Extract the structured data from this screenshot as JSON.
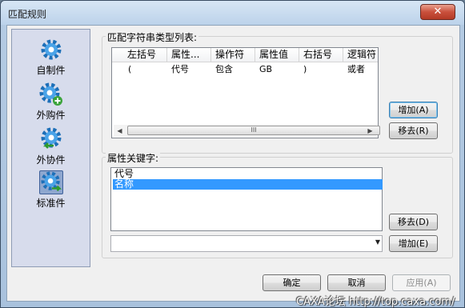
{
  "window": {
    "title": "匹配规则",
    "close_glyph": "✕"
  },
  "sidebar": {
    "items": [
      {
        "label": "自制件",
        "icon": "gear-icon"
      },
      {
        "label": "外购件",
        "icon": "gear-plus-icon"
      },
      {
        "label": "外协件",
        "icon": "gear-arrow-icon"
      },
      {
        "label": "标准件",
        "icon": "gear-arrow-right-icon"
      }
    ]
  },
  "match_list": {
    "label": "匹配字符串类型列表:",
    "columns": [
      "左括号",
      "属性...",
      "操作符",
      "属性值",
      "右括号",
      "逻辑符"
    ],
    "rows": [
      [
        "(",
        "代号",
        "包含",
        "GB",
        ")",
        "或者"
      ]
    ],
    "scroll_thumb_glyph": "III",
    "add_button": "增加(A)",
    "remove_button": "移去(R)"
  },
  "keywords": {
    "label": "属性关键字:",
    "items": [
      "代号",
      "名称"
    ],
    "selected": "名称",
    "remove_button": "移去(D)",
    "add_button": "增加(E)",
    "combo_value": ""
  },
  "footer": {
    "ok": "确定",
    "cancel": "取消",
    "apply": "应用(A)"
  },
  "watermark": "CAXA论坛 http://top.caxa.com/",
  "colors": {
    "selection": "#3399ff",
    "close_button": "#c9503c",
    "sidebar_bg": "#d7dcec"
  }
}
